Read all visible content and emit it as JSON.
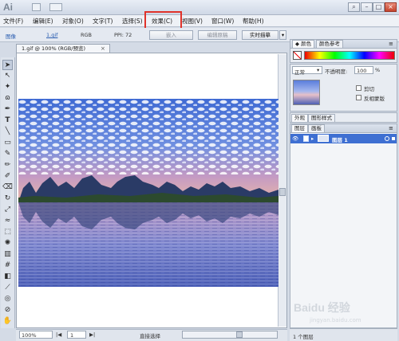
{
  "app": {
    "logo": "Ai"
  },
  "menu": {
    "items": [
      {
        "id": "file",
        "label": "文件(F)"
      },
      {
        "id": "edit",
        "label": "编辑(E)"
      },
      {
        "id": "object",
        "label": "对象(O)"
      },
      {
        "id": "type",
        "label": "文字(T)"
      },
      {
        "id": "select",
        "label": "选择(S)"
      },
      {
        "id": "effect",
        "label": "效果(C)"
      },
      {
        "id": "view",
        "label": "视图(V)"
      },
      {
        "id": "window",
        "label": "窗口(W)"
      },
      {
        "id": "help",
        "label": "帮助(H)"
      }
    ]
  },
  "control_bar": {
    "kind": "图像",
    "filename": "1.gif",
    "mode": "RGB",
    "ppi": "PPI: 72",
    "embed_label": "嵌入",
    "edit_original_label": "编辑原稿",
    "live_trace_label": "实时描摹"
  },
  "document": {
    "tab_title": "1.gif @ 100% (RGB/预览)",
    "close_glyph": "×"
  },
  "status": {
    "zoom": "100%",
    "page": "1",
    "tool_name": "直接选择"
  },
  "color_panel": {
    "tabs": [
      "颜色",
      "颜色参考"
    ]
  },
  "transparency_panel": {
    "blend_mode": "正常",
    "opacity_label": "不透明度:",
    "opacity_value": "100",
    "opacity_unit": "%",
    "clip_label": "剪切",
    "invert_mask_label": "反相蒙版"
  },
  "appearance_panel": {
    "tabs": [
      "外观",
      "图形样式"
    ]
  },
  "layers_panel": {
    "tabs": [
      "图层",
      "画板"
    ],
    "layer_name": "图层 1",
    "footer_count": "1 个图层"
  },
  "watermark": {
    "brand": "Baidu 经验",
    "url": "jingyan.baidu.com"
  },
  "colors": {
    "highlight_box": "#e0322a",
    "selected_layer": "#3e6fd2"
  }
}
